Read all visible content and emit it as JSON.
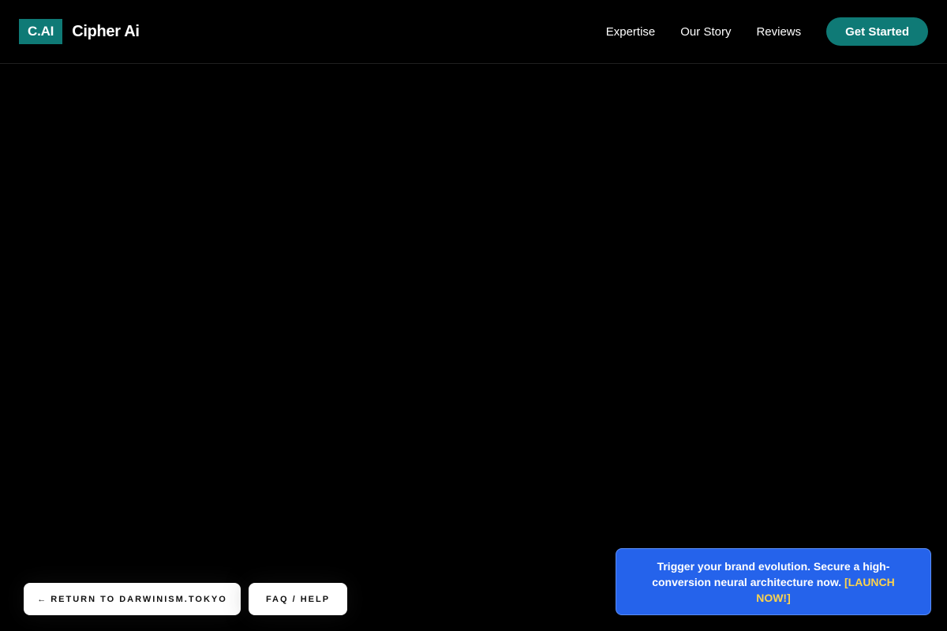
{
  "header": {
    "logo_text": "C.AI",
    "brand_name": "Cipher Ai",
    "nav": [
      "Expertise",
      "Our Story",
      "Reviews"
    ],
    "cta_label": "Get Started"
  },
  "footer_buttons": {
    "return_arrow": "←",
    "return_label": "RETURN TO DARWINISM.TOKYO",
    "faq_label": "FAQ / HELP"
  },
  "promo": {
    "text": "Trigger your brand evolution. Secure a high-conversion neural architecture now.",
    "link_text": "[LAUNCH NOW!]"
  },
  "colors": {
    "background": "#000000",
    "brand_teal": "#0f7a76",
    "promo_blue": "#2563eb",
    "promo_link": "#fcd34d",
    "pill_bg": "#ffffff"
  }
}
